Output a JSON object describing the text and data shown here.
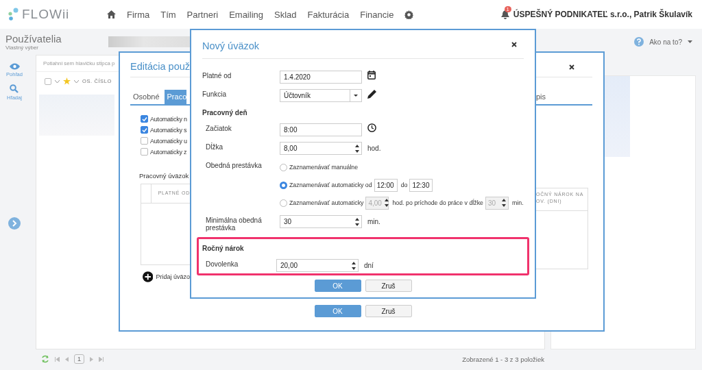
{
  "app": {
    "logo": "FLOWii",
    "nav": [
      "Firma",
      "Tím",
      "Partneri",
      "Emailing",
      "Sklad",
      "Fakturácia",
      "Financie"
    ],
    "notification_count": "1",
    "user": "ÚSPEŠNÝ PODNIKATEĽ s.r.o., Patrik Škulavík"
  },
  "page": {
    "title": "Používatelia",
    "subtitle": "Vlastný výber",
    "help": "Ako na to?"
  },
  "sidebar": [
    {
      "label": "Pohľad",
      "kind": "view"
    },
    {
      "label": "Hľadaj",
      "kind": "search"
    }
  ],
  "grid": {
    "group_hint": "Potiahni sem hlavičku stĺpca p",
    "select_all": {
      "checked": false
    },
    "columns": [
      "OS. ČÍSLO"
    ],
    "page": "1",
    "summary": "Zobrazené 1 - 3 z 3 položiek"
  },
  "edit_dialog": {
    "title": "Editácia použ",
    "tabs": [
      {
        "label": "Osobné",
        "selected": false
      },
      {
        "label": "Praco",
        "selected": true
      },
      {
        "label": "pis",
        "selected": false
      }
    ],
    "checkboxes": [
      {
        "label": "Automaticky n",
        "checked": true
      },
      {
        "label": "Automaticky s",
        "checked": true
      },
      {
        "label": "Automaticky u",
        "checked": false
      },
      {
        "label": "Automaticky z",
        "checked": false
      }
    ],
    "section": "Pracovný úväzok",
    "left_column": "PLATNÉ OD",
    "right_column": [
      "OČNÝ NÁROK NA",
      "OV. (DNI)"
    ],
    "add": "Pridaj úväzo",
    "buttons": [
      "OK",
      "Zruš"
    ]
  },
  "new_dialog": {
    "title": "Nový úväzok",
    "rows": [
      {
        "kind": "date",
        "label": "Platné od",
        "value": "1.4.2020"
      },
      {
        "kind": "select",
        "label": "Funkcia",
        "value": "Účtovník"
      },
      {
        "kind": "heading",
        "label": "Pracovný deň"
      },
      {
        "kind": "time",
        "label": "Začiatok",
        "value": "8:00"
      },
      {
        "kind": "number",
        "label": "Dĺžka",
        "value": "8,00",
        "unit": "hod."
      },
      {
        "kind": "radios",
        "label": "Obedná prestávka",
        "options": [
          {
            "selected": false,
            "parts": [
              {
                "kind": "text",
                "text": "Zaznamenávať manuálne"
              }
            ]
          },
          {
            "selected": true,
            "parts": [
              {
                "kind": "text",
                "text": "Zaznamenávať automaticky od"
              },
              {
                "kind": "field",
                "text": "12:00"
              },
              {
                "kind": "text",
                "text": "do"
              },
              {
                "kind": "field",
                "text": "12:30"
              }
            ]
          },
          {
            "selected": false,
            "parts": [
              {
                "kind": "text",
                "text": "Zaznamenávať automaticky"
              },
              {
                "kind": "spinner",
                "text": "4,00"
              },
              {
                "kind": "text",
                "text": "hod. po príchode do práce v dĺžke"
              },
              {
                "kind": "spinner",
                "text": "30"
              },
              {
                "kind": "text",
                "text": "min."
              }
            ]
          }
        ]
      },
      {
        "kind": "number",
        "label": "Minimálna obedná prestávka",
        "value": "30",
        "unit": "min."
      }
    ],
    "highlight": {
      "heading": "Ročný nárok",
      "label": "Dovolenka",
      "value": "20,00",
      "unit": "dní"
    },
    "buttons": [
      "OK",
      "Zruš"
    ]
  }
}
